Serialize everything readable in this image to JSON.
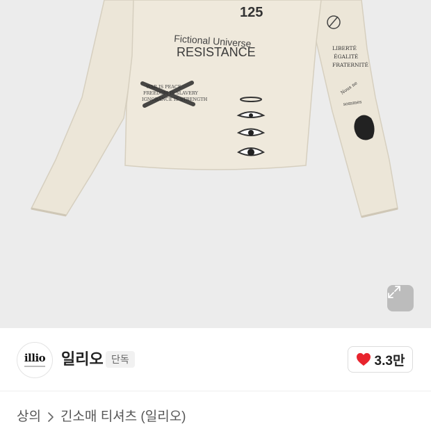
{
  "product_image": {
    "graphic_texts": {
      "number": "125",
      "headline_top": "Fictional Universe",
      "headline_main": "RESISTANCE",
      "slogan_1": "WAR IS PEACE",
      "slogan_2": "FREEDOM IS SLAVERY",
      "slogan_3": "IGNORANCE IS STRENGTH",
      "sleeve_1": "LIBERTÉ",
      "sleeve_2": "ÉGALITÉ",
      "sleeve_3": "FRATERNITÉ",
      "sleeve_4": "Nous ne",
      "sleeve_5": "sommes"
    },
    "shirt_color": "#ece6d8",
    "background_color": "#ececec"
  },
  "expand_icon": "expand-arrows-icon",
  "shop": {
    "logo_text": "illio",
    "name": "일리오",
    "badge": "단독"
  },
  "like": {
    "icon": "heart-icon",
    "count": "3.3만",
    "heart_color": "#e8242e"
  },
  "breadcrumb": {
    "items": [
      "상의",
      "긴소매 티셔츠 (일리오)"
    ],
    "separator_icon": "chevron-right-icon"
  }
}
